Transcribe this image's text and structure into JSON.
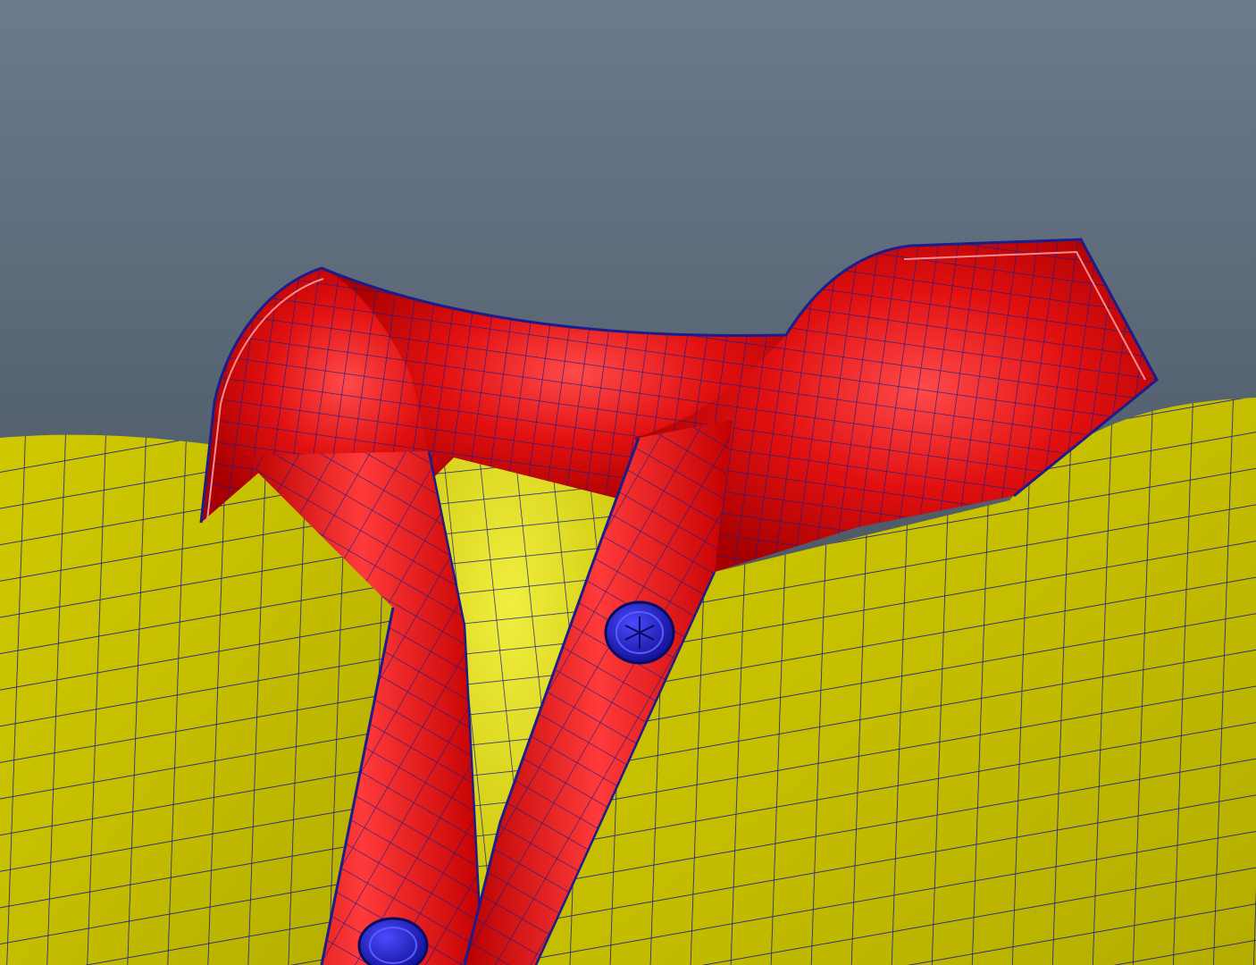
{
  "viewport": {
    "colors": {
      "background_top": "#6b7b8d",
      "background_bottom": "#39424c",
      "shirt_body": "#cfc800",
      "shirt_body_light": "#e6e41a",
      "collar": "#e11010",
      "collar_dark": "#a80000",
      "wireframe": "#1c1c8a",
      "button": "#1616b8"
    },
    "objects": [
      "shirt-body-mesh",
      "collar-mesh",
      "placket-mesh",
      "button-upper",
      "button-lower"
    ]
  }
}
